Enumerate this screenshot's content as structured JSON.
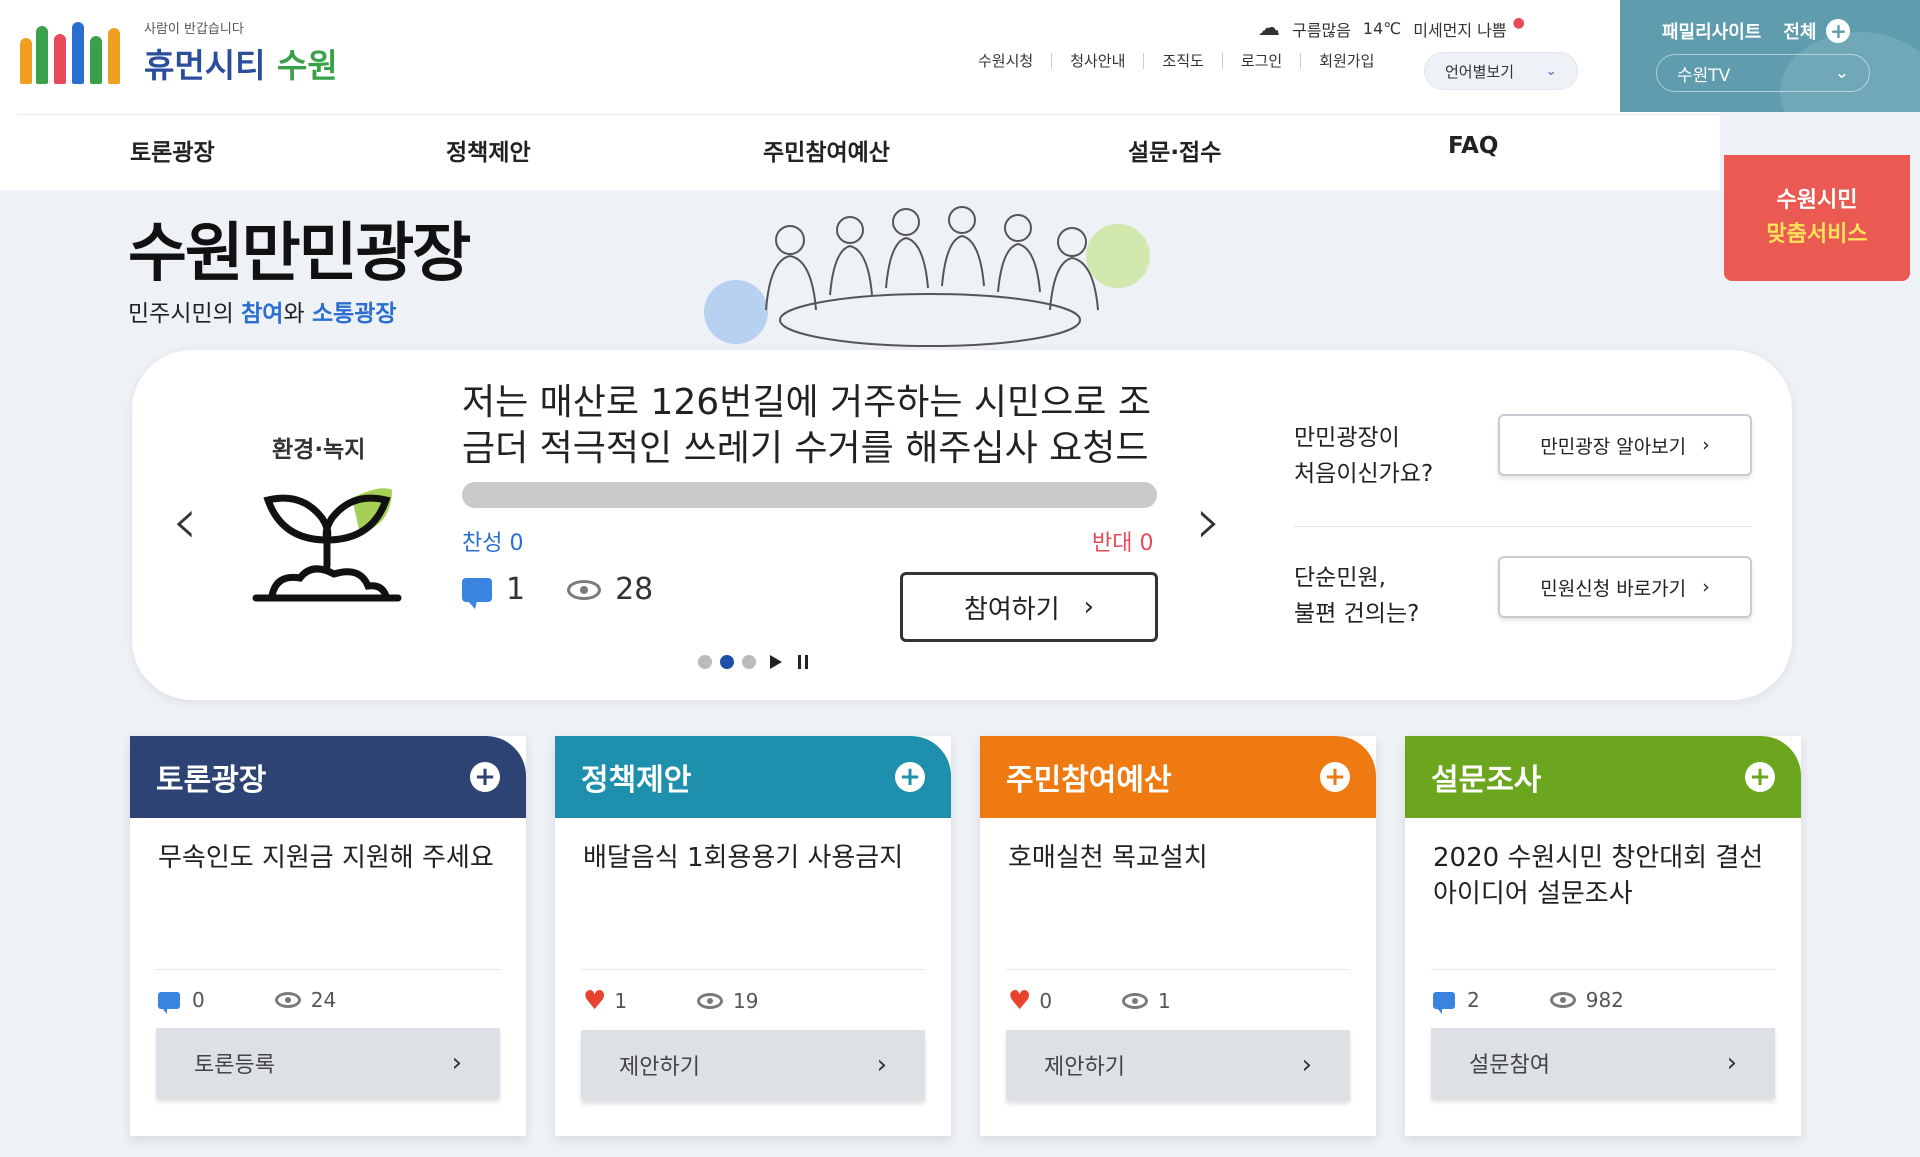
{
  "header": {
    "logo_slogan": "사람이 반갑습니다",
    "logo_name_main": "휴먼시티",
    "logo_name_accent": "수원",
    "weather": {
      "icon": "cloud-icon",
      "condition": "구름많음",
      "temperature": "14℃",
      "dust": "미세먼지 나쁨"
    },
    "util_links": [
      "수원시청",
      "청사안내",
      "조직도",
      "로그인",
      "회원가입"
    ],
    "language_select": "언어별보기",
    "family_site": {
      "label": "패밀리사이트",
      "all": "전체",
      "tv": "수원TV"
    },
    "custom_service": {
      "line1": "수원시민",
      "line2": "맞춤서비스"
    },
    "gnb": [
      "토론광장",
      "정책제안",
      "주민참여예산",
      "설문·접수",
      "FAQ"
    ]
  },
  "hero": {
    "title": "수원만민광장",
    "sub_prefix": "민주시민의 ",
    "sub_hl1": "참여",
    "sub_mid": "와 ",
    "sub_hl2": "소통광장"
  },
  "carousel": {
    "category": "환경·녹지",
    "title": "저는 매산로 126번길에 거주하는 시민으로 조금더 적극적인 쓰레기 수거를 해주십사 요청드",
    "agree": "찬성 0",
    "disagree": "반대 0",
    "agree_ratio": 0,
    "comments": "1",
    "views": "28",
    "join_label": "참여하기",
    "slides_total": 3,
    "current_slide": 2
  },
  "side": {
    "q1_line1": "만민광장이",
    "q1_line2": "처음이신가요?",
    "btn1": "만민광장 알아보기",
    "q2_line1": "단순민원,",
    "q2_line2": "불편 건의는?",
    "btn2": "민원신청 바로가기"
  },
  "cards": [
    {
      "title": "토론광장",
      "color": "#2c4373",
      "body": "무속인도 지원금 지원해 주세요",
      "stat1_type": "comment",
      "stat1": "0",
      "views": "24",
      "action": "토론등록"
    },
    {
      "title": "정책제안",
      "color": "#1f8fae",
      "body": "배달음식 1회용용기 사용금지",
      "stat1_type": "heart",
      "stat1": "1",
      "views": "19",
      "action": "제안하기"
    },
    {
      "title": "주민참여예산",
      "color": "#ef7a12",
      "body": "호매실천 목교설치",
      "stat1_type": "heart",
      "stat1": "0",
      "views": "1",
      "action": "제안하기"
    },
    {
      "title": "설문조사",
      "color": "#6ca51e",
      "body": "2020 수원시민 창안대회 결선 아이디어 설문조사",
      "stat1_type": "comment",
      "stat1": "2",
      "views": "982",
      "action": "설문참여"
    }
  ]
}
